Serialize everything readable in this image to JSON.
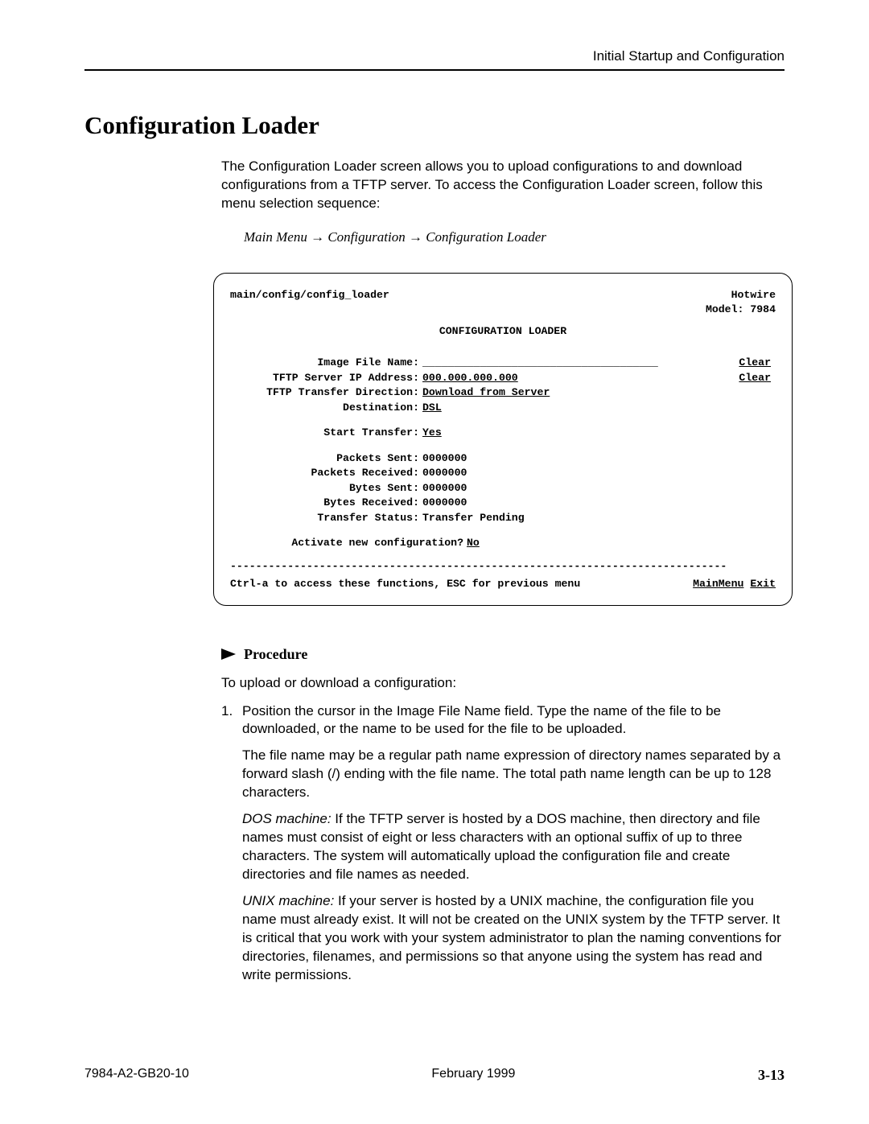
{
  "header": {
    "chapter": "Initial Startup and Configuration"
  },
  "section": {
    "title": "Configuration Loader",
    "intro": "The Configuration Loader screen allows you to upload configurations to and download configurations from a TFTP server. To access the Configuration Loader screen, follow this menu selection sequence:",
    "nav_path": "Main Menu → Configuration → Configuration Loader"
  },
  "terminal": {
    "path": "main/config/config_loader",
    "brand": "Hotwire",
    "model": "Model: 7984",
    "title": "CONFIGURATION LOADER",
    "fields": {
      "image_file_name": {
        "label": "Image File Name:",
        "value": "_____________________________________",
        "clear": "Clear"
      },
      "tftp_ip": {
        "label": "TFTP Server IP Address:",
        "value": " 000.000.000.000",
        "clear": "Clear"
      },
      "transfer_dir": {
        "label": "TFTP Transfer Direction:",
        "value": " Download from Server"
      },
      "destination": {
        "label": "Destination:",
        "value": " DSL"
      },
      "start_transfer": {
        "label": "Start Transfer:",
        "value": " Yes"
      },
      "packets_sent": {
        "label": "Packets Sent:",
        "value": "0000000"
      },
      "packets_received": {
        "label": "Packets Received:",
        "value": "0000000"
      },
      "bytes_sent": {
        "label": "Bytes Sent:",
        "value": "0000000"
      },
      "bytes_received": {
        "label": "Bytes Received:",
        "value": "0000000"
      },
      "transfer_status": {
        "label": "Transfer Status:",
        "value": "Transfer Pending"
      },
      "activate": {
        "label": "Activate new configuration?",
        "value": " No "
      }
    },
    "footer_hint": "Ctrl-a to access these functions, ESC for previous menu",
    "footer_main": "MainMenu",
    "footer_exit": "Exit",
    "dashes": "------------------------------------------------------------------------------"
  },
  "procedure": {
    "heading": "Procedure",
    "lead": "To upload or download a configuration:",
    "step1_num": "1.",
    "step1": "Position the cursor in the Image File Name field. Type the name of the file to be downloaded, or the name to be used for the file to be uploaded.",
    "step1_p2": "The file name may be a regular path name expression of directory names separated by a forward slash (/) ending with the file name. The total path name length can be up to 128 characters.",
    "step1_dos_it": "DOS machine:",
    "step1_dos": " If the TFTP server is hosted by a DOS machine, then directory and file names must consist of eight or less characters with an optional suffix of up to three characters. The system will automatically upload the configuration file and create directories and file names as needed.",
    "step1_unix_it": "UNIX machine:",
    "step1_unix": " If your server is hosted by a UNIX machine, the configuration file you name must already exist. It will not be created on the UNIX system by the TFTP server. It is critical that you work with your system administrator to plan the naming conventions for directories, filenames, and permissions so that anyone using the system has read and write permissions."
  },
  "footer": {
    "doc_id": "7984-A2-GB20-10",
    "date": "February 1999",
    "page": "3-13"
  }
}
